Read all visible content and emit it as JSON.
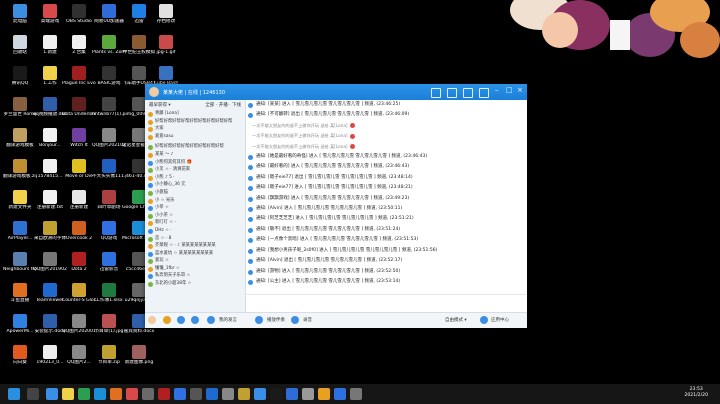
{
  "desktop": {
    "icons": [
      {
        "label": "此电脑",
        "col": 0,
        "row": 0,
        "color": "#3b8fe0"
      },
      {
        "label": "高端游戏",
        "col": 1,
        "row": 0,
        "color": "#d84a4a"
      },
      {
        "label": "OBS Studio",
        "col": 2,
        "row": 0,
        "color": "#303030"
      },
      {
        "label": "网易UU加速器",
        "col": 3,
        "row": 0,
        "color": "#2f6cd8"
      },
      {
        "label": "迅雷",
        "col": 4,
        "row": 0,
        "color": "#1e7fe5"
      },
      {
        "label": "存档修改",
        "col": 5,
        "row": 0,
        "color": "#e0e0e0"
      },
      {
        "label": "回收站",
        "col": 0,
        "row": 1,
        "color": "#cfd8e0"
      },
      {
        "label": "1.新建",
        "col": 1,
        "row": 1,
        "color": "#f0f0f0"
      },
      {
        "label": "2.合集",
        "col": 2,
        "row": 1,
        "color": "#f0f0f0"
      },
      {
        "label": "Plants vs. Zombies G...",
        "col": 3,
        "row": 1,
        "color": "#5ca83a"
      },
      {
        "label": "中世纪王权模拟",
        "col": 4,
        "row": 1,
        "color": "#8a5a30"
      },
      {
        "label": "jpg-1.gif",
        "col": 5,
        "row": 1,
        "color": "#c94a4a"
      },
      {
        "label": "腾讯QQ",
        "col": 0,
        "row": 2,
        "color": "#1a1a1a"
      },
      {
        "label": "1.工作",
        "col": 1,
        "row": 2,
        "color": "#f0d24a"
      },
      {
        "label": "Plague Inc Evolved",
        "col": 2,
        "row": 2,
        "color": "#a02020"
      },
      {
        "label": "BASIC游戏",
        "col": 3,
        "row": 2,
        "color": "#333"
      },
      {
        "label": "飞车助手USB47",
        "col": 4,
        "row": 2,
        "color": "#555"
      },
      {
        "label": "Cube Bash",
        "col": 5,
        "row": 2,
        "color": "#3a70c0"
      },
      {
        "label": "罗兰盛世 Rome",
        "col": 0,
        "row": 3,
        "color": "#886040"
      },
      {
        "label": "qq视频播放.docx",
        "col": 1,
        "row": 3,
        "color": "#2f5faa"
      },
      {
        "label": "Dota Underlords",
        "col": 2,
        "row": 3,
        "color": "#602020"
      },
      {
        "label": "hntwnb?7(1).png",
        "col": 3,
        "row": 3,
        "color": "#444"
      },
      {
        "label": "img_0094...",
        "col": 4,
        "row": 3,
        "color": "#555"
      },
      {
        "label": "翻译游戏模板",
        "col": 0,
        "row": 4,
        "color": "#c0a060"
      },
      {
        "label": "Bonjour...",
        "col": 1,
        "row": 4,
        "color": "#f0f0f0"
      },
      {
        "label": "Witch It",
        "col": 2,
        "row": 4,
        "color": "#7040a0"
      },
      {
        "label": "QQ图片2021020...",
        "col": 3,
        "row": 4,
        "color": "#888"
      },
      {
        "label": "诺诺星星截图.png",
        "col": 4,
        "row": 4,
        "color": "#777"
      },
      {
        "label": "翻译游戏模板.zip",
        "col": 0,
        "row": 5,
        "color": "#c09030"
      },
      {
        "label": "1578415...",
        "col": 1,
        "row": 5,
        "color": "#f0f0f0"
      },
      {
        "label": "Move or Die",
        "col": 2,
        "row": 5,
        "color": "#e0c020"
      },
      {
        "label": "不大头头像111.psd",
        "col": 3,
        "row": 5,
        "color": "#2060c0"
      },
      {
        "label": "461-40.doc",
        "col": 4,
        "row": 5,
        "color": "#333"
      },
      {
        "label": "新建文件夹",
        "col": 0,
        "row": 6,
        "color": "#f0d24a"
      },
      {
        "label": "注册新建.txt",
        "col": 1,
        "row": 6,
        "color": "#f0f0f0"
      },
      {
        "label": "注册新建",
        "col": 2,
        "row": 6,
        "color": "#e8e8e8"
      },
      {
        "label": "四叶草剧场",
        "col": 3,
        "row": 6,
        "color": "#aa4040"
      },
      {
        "label": "Google Chrome",
        "col": 4,
        "row": 6,
        "color": "#2b9e4f"
      },
      {
        "label": "AirPlayer...",
        "col": 0,
        "row": 7,
        "color": "#3070d0"
      },
      {
        "label": "来自欧洲的字体",
        "col": 1,
        "row": 7,
        "color": "#c0a030"
      },
      {
        "label": "Overcook 2",
        "col": 2,
        "row": 7,
        "color": "#d06020"
      },
      {
        "label": "QQ游戏",
        "col": 3,
        "row": 7,
        "color": "#3070e0"
      },
      {
        "label": "Microsoft Edge",
        "col": 4,
        "row": 7,
        "color": "#1a8fd8"
      },
      {
        "label": "Neighbours from Hell",
        "col": 0,
        "row": 8,
        "color": "#5a80b0"
      },
      {
        "label": "QQ图片2019021...",
        "col": 1,
        "row": 8,
        "color": "#777"
      },
      {
        "label": "Dota 2",
        "col": 2,
        "row": 8,
        "color": "#b02020"
      },
      {
        "label": "迅雷影音",
        "col": 3,
        "row": 8,
        "color": "#2f70e0"
      },
      {
        "label": "c5cc46e5...",
        "col": 4,
        "row": 8,
        "color": "#555"
      },
      {
        "label": "斗鱼直播",
        "col": 0,
        "row": 9,
        "color": "#e07020"
      },
      {
        "label": "TeamViewer",
        "col": 1,
        "row": 9,
        "color": "#1e6ad0"
      },
      {
        "label": "Counter-S Global Off...",
        "col": 2,
        "row": 9,
        "color": "#d0a030"
      },
      {
        "label": "工作簿1.xlsx",
        "col": 3,
        "row": 9,
        "color": "#1f7a3f"
      },
      {
        "label": "u29qnjyah...",
        "col": 4,
        "row": 9,
        "color": "#666"
      },
      {
        "label": "ApowerMi...",
        "col": 0,
        "row": 10,
        "color": "#2f80e0"
      },
      {
        "label": "安装提示.docx",
        "col": 1,
        "row": 10,
        "color": "#2f5faa"
      },
      {
        "label": "QQ图片20200128...",
        "col": 2,
        "row": 10,
        "color": "#888"
      },
      {
        "label": "节目单(1).jpg",
        "col": 3,
        "row": 10,
        "color": "#bb5050"
      },
      {
        "label": "嘉宾资料.docx",
        "col": 4,
        "row": 10,
        "color": "#2f5faa"
      },
      {
        "label": "向日葵",
        "col": 0,
        "row": 11,
        "color": "#e05a20"
      },
      {
        "label": "190213_0...",
        "col": 1,
        "row": 11,
        "color": "#eee"
      },
      {
        "label": "QQ图片2...",
        "col": 2,
        "row": 11,
        "color": "#888"
      },
      {
        "label": "节目单.zip",
        "col": 3,
        "row": 11,
        "color": "#c0a030"
      },
      {
        "label": "新建图像.png",
        "col": 4,
        "row": 11,
        "color": "#a06060"
      }
    ]
  },
  "chat": {
    "title": "某某大佬 | 在线 | 1246130",
    "left_header": {
      "a": "最早获得 ▾",
      "b": "全部 · 开播 · 下线"
    },
    "top_users": [
      {
        "text": "青藤 [Lona]",
        "color": "#e8a020"
      },
      {
        "text": "好帮好帮好帮好帮好帮好帮好帮好帮好帮",
        "color": "#e8a020"
      },
      {
        "text": "大家",
        "color": "#e8a020"
      },
      {
        "text": "爱爱sasu",
        "color": "#e8a020"
      }
    ],
    "members": [
      "好帮好帮好帮好帮好帮好帮好帮好帮",
      "某某 〜 ♪",
      "小熊何其何其何 🎁",
      "小叉 ☆ · 清爽花束",
      "小熊 ♪ 5 ·",
      "小小静心_36 元",
      "小盘猫",
      "小 ☆ 光乐",
      "小莘 ☆",
      "小小茶 ☆",
      "新叮叮 ☆ ·",
      "DHz ☆ ·",
      "恋 ☆ · 8",
      "芥茉呢 ☆ · ♪ 某某某某某某某某",
      "蓝水爱坑 ☆ 某某某某某某某某",
      "爱玩 ☆",
      "懂懂_1fbr ☆",
      "私奔到天子乐哥 ☆",
      "东北的小超38年 ☆"
    ],
    "messages": [
      {
        "kind": "notice",
        "text": "通知: [某某] 进入 [ 雪儿雪儿雪儿雪 雪儿雪儿雪儿雪 ] 频道, (23:46:25)"
      },
      {
        "kind": "notice",
        "text": "通知: [不可翻转] 退出 [ 雪儿雪儿雪儿雪 雪儿雪儿雪儿雪 ] 频道, (23:46:09)"
      },
      {
        "kind": "gift",
        "text": "一次不能太朋友的的谁不上做你开玩 送给 某[Lona]"
      },
      {
        "kind": "gift",
        "text": "一次不能太朋友的的谁不上做你开玩 送给 某[Lona]"
      },
      {
        "kind": "gift",
        "text": "一次不能太朋友的的谁不上做你开玩 送给 某[Lona]"
      },
      {
        "kind": "notice",
        "text": "通知: [她是最好看的奇怪] 进入 [ 雪儿雪儿雪儿雪 雪儿雪儿雪儿雪 ] 频道, (23:46:43)"
      },
      {
        "kind": "notice",
        "text": "通知: [最好看的] 进入 [ 雪儿雪儿雪儿雪 雪儿雪儿雪儿雪 ] 频道, (23:46:43)"
      },
      {
        "kind": "notice",
        "text": "通知: [嗯子eie77] 退出 [ 雪儿雪儿雪儿雪 雪儿雪儿雪儿雪 ] 频道, (23:48:14)"
      },
      {
        "kind": "notice",
        "text": "通知: [嗯子eie77] 进入 [ 雪儿雪儿雪儿雪 雪儿雪儿雪儿雪 ] 频道, (23:48:21)"
      },
      {
        "kind": "notice",
        "text": "通知: [飘飘游戏] 进入 [ 雪儿雪儿雪儿雪 雪儿雪儿雪儿雪 ] 频道, (23:49:23)"
      },
      {
        "kind": "notice",
        "text": "通知: [Alvin] 进入 [ 雪儿雪儿雪儿雪 雪儿雪儿雪儿雪 ] 频道, (23:50:11)"
      },
      {
        "kind": "notice",
        "text": "通知: [阿芝芝芝芝] 进入 [ 雪儿雪儿雪儿雪 雪儿雪儿雪儿雪 ] 频道, (23:51:21)"
      },
      {
        "kind": "notice",
        "text": "通知: [敬不] 退出 [ 雪儿雪儿雪儿雪 雪儿雪儿雪儿雪 ] 频道, (23:51:24)"
      },
      {
        "kind": "notice",
        "text": "通知: [一点像个黑暗] 进入 [ 雪儿雪儿雪儿雪 雪儿雪儿雪儿雪 ] 频道, (23:51:53)"
      },
      {
        "kind": "notice",
        "text": "通知: [我想小男孩子呢_2s0f0] 进入 [ 雪儿雪儿雪儿雪 雪儿雪儿雪儿雪 ] 频道, (23:51:56)"
      },
      {
        "kind": "notice",
        "text": "通知: [Alvin] 退出 [ 雪儿雪儿雪儿雪 雪儿雪儿雪儿雪 ] 频道, (23:52:17)"
      },
      {
        "kind": "notice",
        "text": "通知: [游物] 进入 [ 雪儿雪儿雪儿雪 雪儿雪儿雪儿雪 ] 频道, (23:52:50)"
      },
      {
        "kind": "notice",
        "text": "通知: [公主] 进入 [ 雪儿雪儿雪儿雪 雪儿雪儿雪儿雪 ] 频道, (23:53:14)"
      }
    ],
    "bottom": {
      "mic_label": "我的发言",
      "play_label": "播放伴奏",
      "record_label": "录音",
      "mode_label": "自由模式 ▾",
      "app_label": "应用中心"
    }
  },
  "taskbar": {
    "time": "23:53",
    "date": "2021/2/20",
    "apps": [
      "#3a8ee6",
      "#f0d24a",
      "#2b9e4f",
      "#1a8fd8",
      "#e07020",
      "#d84a4a",
      "#6a6a6a",
      "#b02020",
      "#3070e0",
      "#555",
      "#1e6ad0",
      "#888",
      "#c0a030",
      "#3a8ee6",
      "#1a1a1a",
      "#2f6cd8",
      "#999",
      "#e8a020",
      "#2f70e0",
      "#777"
    ]
  }
}
